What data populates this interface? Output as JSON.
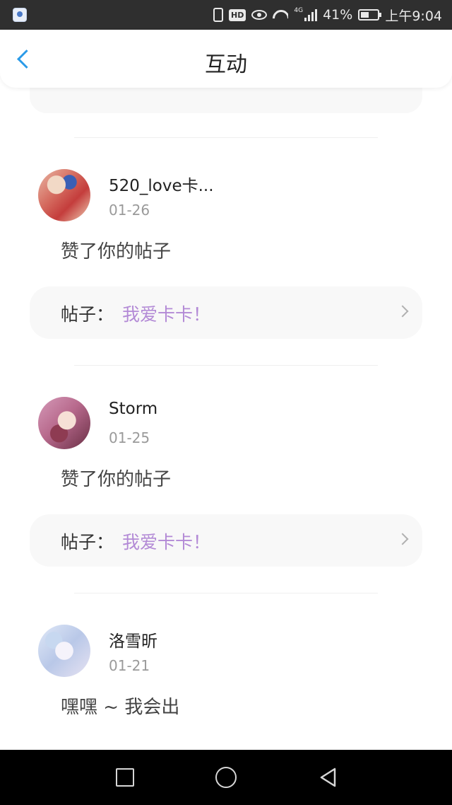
{
  "status_bar": {
    "hd": "HD",
    "network": "4G",
    "battery_percent": "41%",
    "time": "上午9:04"
  },
  "header": {
    "title": "互动",
    "back_icon": "chevron-left-icon"
  },
  "notifications": [
    {
      "username": "520_love卡...",
      "date": "01-26",
      "action": "赞了你的帖子",
      "post_label": "帖子：",
      "post_title": "我爱卡卡！"
    },
    {
      "username": "Storm",
      "date": "01-25",
      "action": "赞了你的帖子",
      "post_label": "帖子：",
      "post_title": "我爱卡卡！"
    },
    {
      "username": "洛雪昕",
      "date": "01-21",
      "action": "嘿嘿 ~ 我会出"
    }
  ],
  "colors": {
    "accent_blue": "#2b9be8",
    "post_title_purple": "#b38ad6",
    "date_gray": "#9a9a9a",
    "card_bg": "#f8f8f8"
  },
  "nav_bar": {
    "recent_icon": "square-icon",
    "home_icon": "circle-icon",
    "back_icon": "triangle-back-icon"
  }
}
